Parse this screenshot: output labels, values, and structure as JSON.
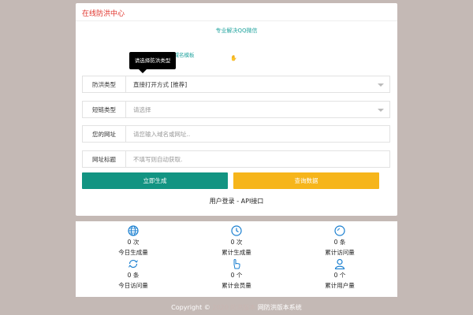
{
  "header": {
    "title": "在线防洪中心"
  },
  "links": {
    "qq": "专业解决QQ微信",
    "sub": "已域名模板"
  },
  "tooltip": "请选择防洪类型",
  "form": {
    "rows": [
      {
        "label": "防洪类型",
        "value": "直接打开方式 [推荐]",
        "select": true
      },
      {
        "label": "短链类型",
        "value": "请选择",
        "select": true
      },
      {
        "label": "您的网址",
        "placeholder": "请您输入域名或网址.."
      },
      {
        "label": "网址标题",
        "placeholder": "不填写则自动获取."
      }
    ]
  },
  "buttons": {
    "generate": "立即生成",
    "query": "查询数据"
  },
  "footer_links": {
    "login": "用户登录",
    "sep": " - ",
    "api": "API接口"
  },
  "stats": [
    {
      "icon": "globe-icon",
      "num": "0 次",
      "caption": "今日生成量"
    },
    {
      "icon": "clock-icon",
      "num": "0 次",
      "caption": "累计生成量"
    },
    {
      "icon": "search-icon",
      "num": "0 条",
      "caption": "累计访问量"
    },
    {
      "icon": "refresh-icon",
      "num": "0 条",
      "caption": "今日访问量"
    },
    {
      "icon": "hand-icon",
      "num": "0 个",
      "caption": "累计会员量"
    },
    {
      "icon": "user-icon",
      "num": "0 个",
      "caption": "累计用户量"
    }
  ],
  "copyright": {
    "prefix": "Copyright ©",
    "blurred": "2020 防洪版本",
    "suffix": "网防洪版本系统"
  },
  "colors": {
    "accent": "#129482",
    "warn": "#f6b51a",
    "title": "#e0332b",
    "icon": "#1a7fd0"
  }
}
